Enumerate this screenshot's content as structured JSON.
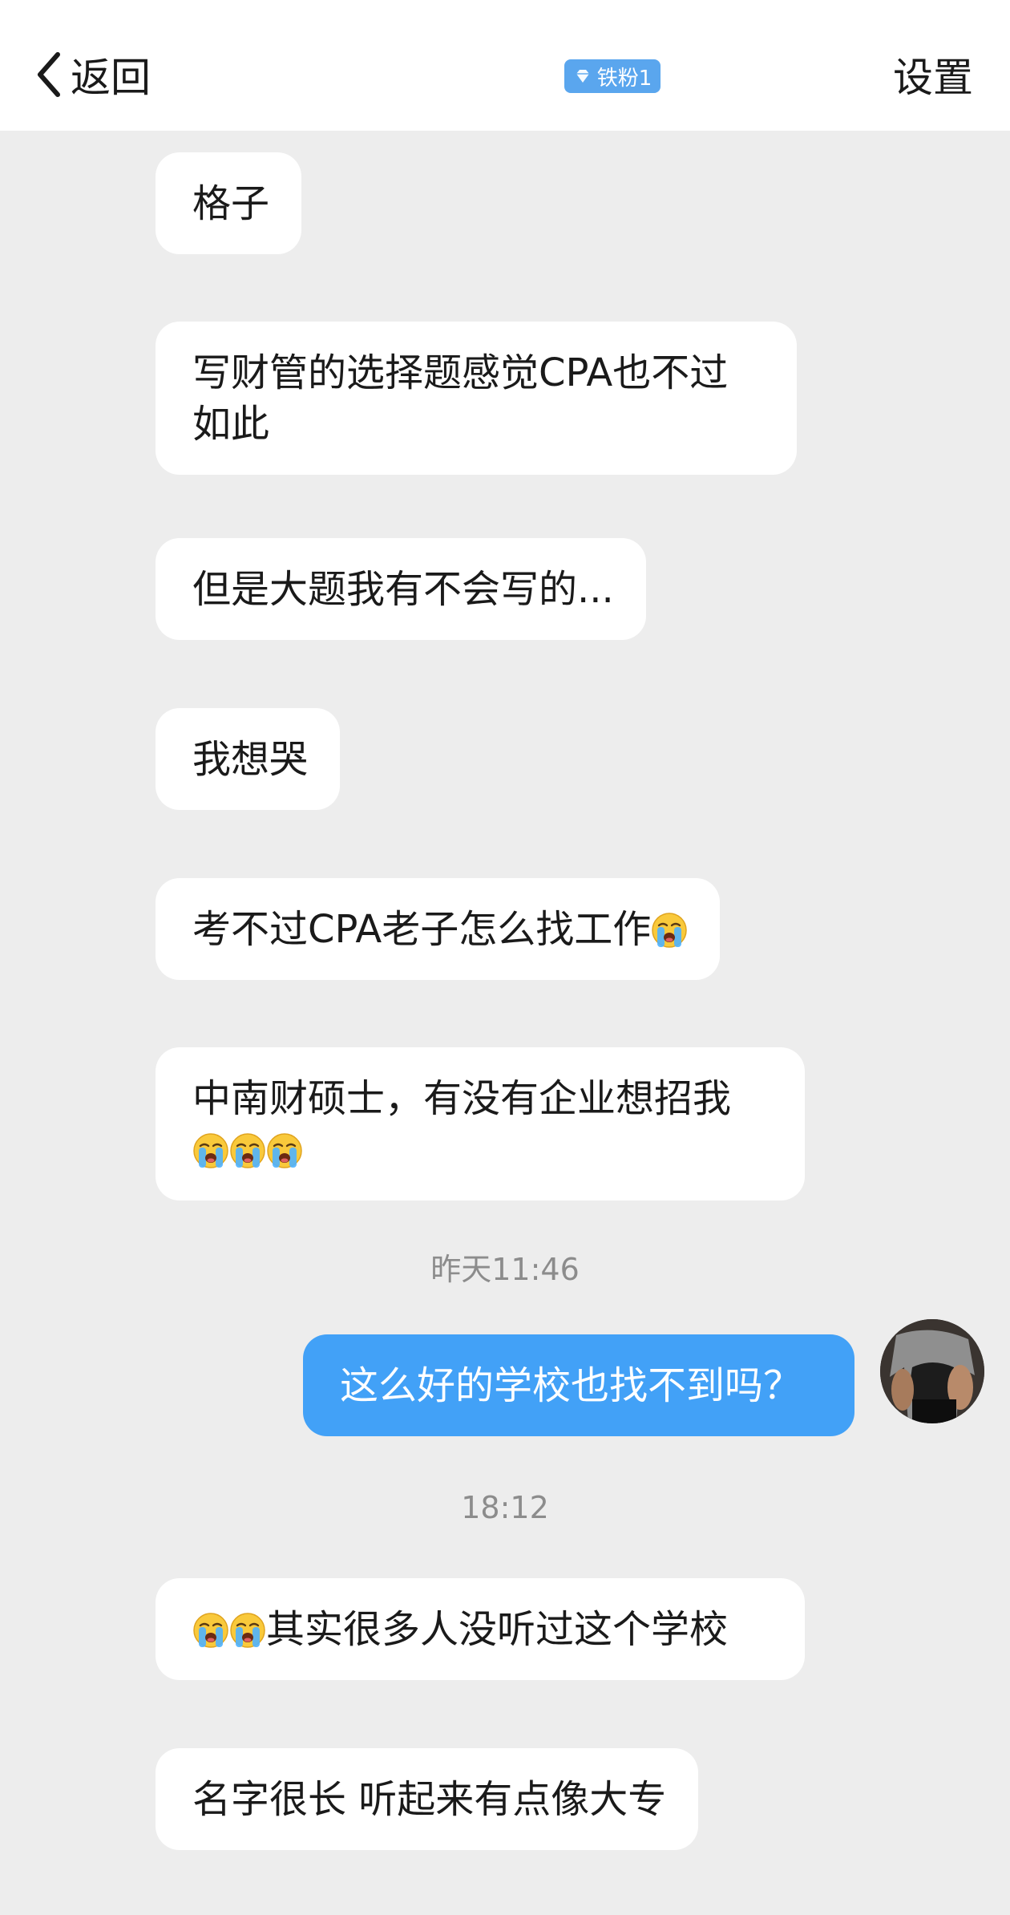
{
  "header": {
    "back_label": "返回",
    "fan_badge": "铁粉1",
    "settings_label": "设置"
  },
  "messages": [
    {
      "text": "格子"
    },
    {
      "text": "写财管的选择题感觉CPA也不过如此",
      "line1": "写财管的选择题感觉CPA也不过",
      "line2": "如此"
    },
    {
      "text": "但是大题我有不会写的..."
    },
    {
      "text": "我想哭"
    },
    {
      "text": "考不过CPA老子怎么找工作",
      "emoji": "loudly-crying-face"
    },
    {
      "text": "中南财硕士，有没有企业想招我",
      "emoji_count": 3
    },
    {
      "timestamp": "昨天11:46"
    },
    {
      "text": "这么好的学校也找不到吗？",
      "outgoing": true
    },
    {
      "timestamp": "18:12"
    },
    {
      "text": "其实很多人没听过这个学校",
      "emoji_count": 2
    },
    {
      "text": "名字很长 听起来有点像大专"
    }
  ],
  "colors": {
    "background": "#ededed",
    "incoming_bubble": "#ffffff",
    "outgoing_bubble": "#42a1f7",
    "badge": "#5aa6ee",
    "timestamp": "#8c8c8c"
  }
}
